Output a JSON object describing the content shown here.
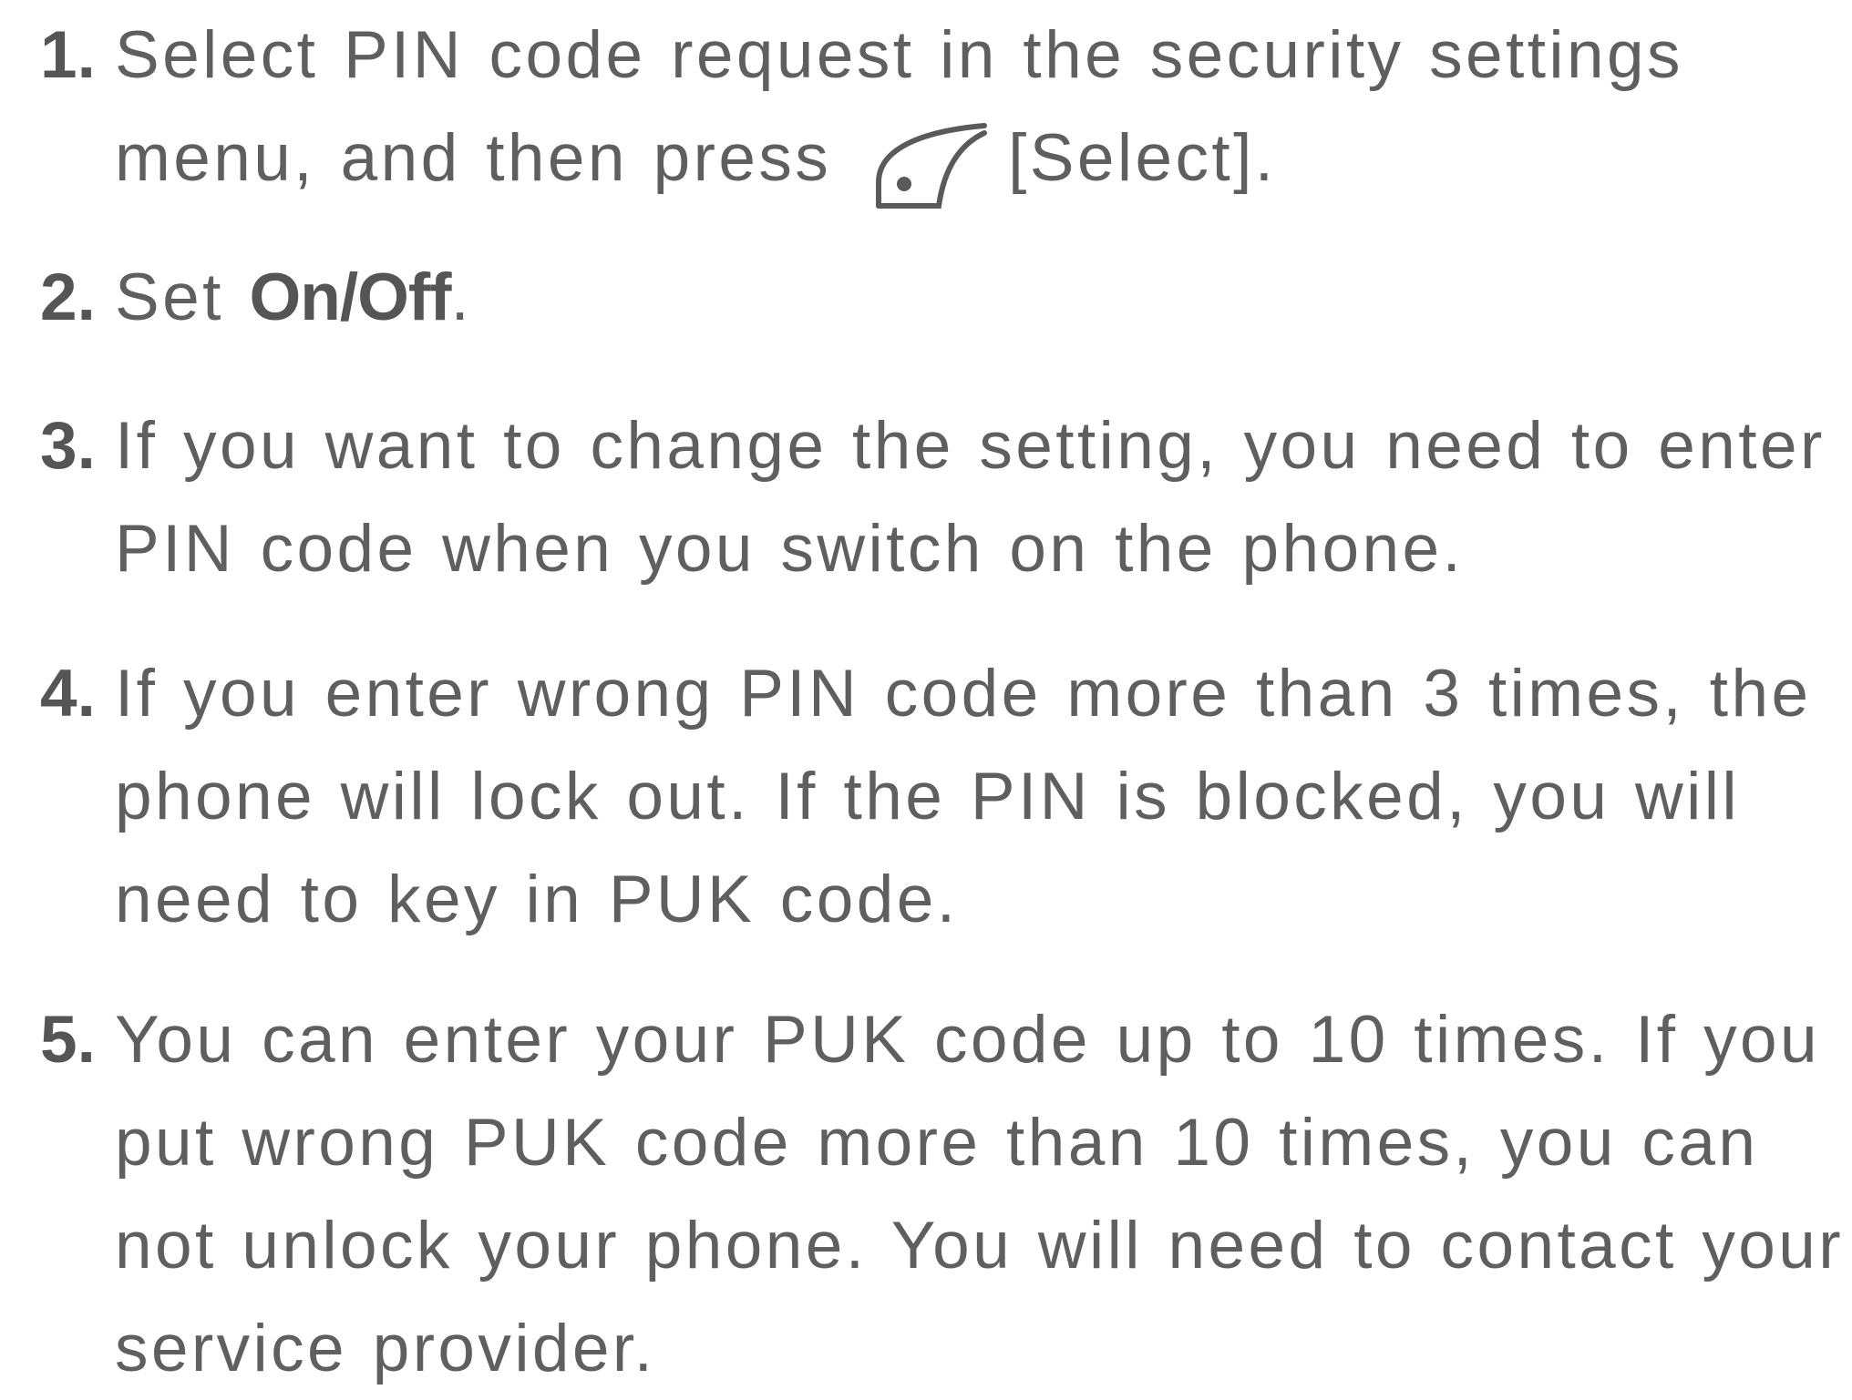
{
  "steps": [
    {
      "number": "1.",
      "line1": "Select PIN code request in the security settings",
      "line2_before_icon": "menu, and then press",
      "icon": "left-soft-key-icon",
      "line2_after_icon": "[Select]."
    },
    {
      "number": "2.",
      "text_before": "Set ",
      "bold_text": "On/Off",
      "text_after": "."
    },
    {
      "number": "3.",
      "lines": [
        "If you want to change the setting, you need to enter",
        "PIN code when you switch on the phone."
      ]
    },
    {
      "number": "4.",
      "lines": [
        "If you enter wrong PIN code more than 3 times, the",
        "phone will lock out. If the PIN is blocked, you will",
        "need to key in PUK code."
      ]
    },
    {
      "number": "5.",
      "lines": [
        "You can enter your PUK code up to 10 times. If you",
        "put wrong PUK code more than 10 times, you can",
        "not unlock your phone. You will need to contact your",
        "service provider."
      ]
    }
  ],
  "colors": {
    "text": "#5f5f5f",
    "numbers": "#555555",
    "background": "#ffffff"
  }
}
